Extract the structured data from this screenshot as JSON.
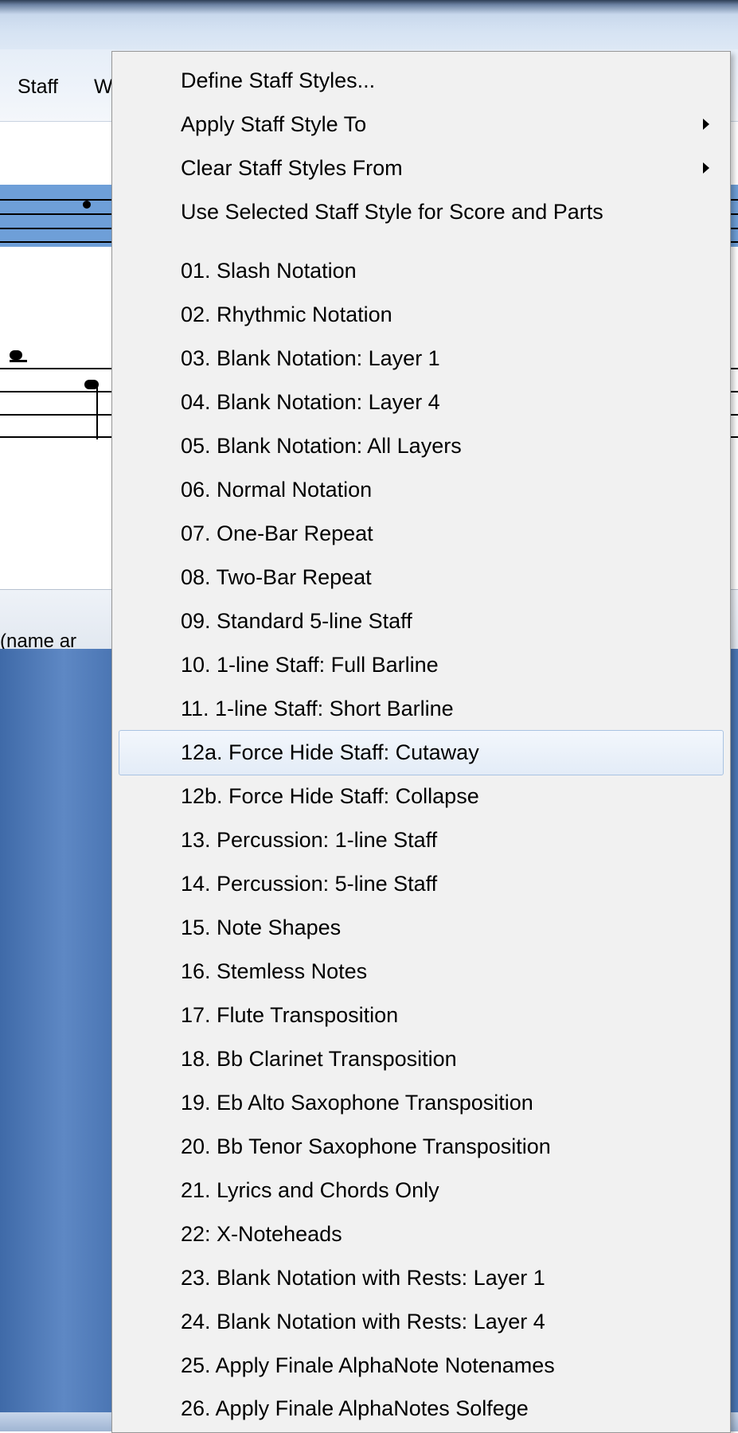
{
  "menubar": {
    "staff_label": "Staff",
    "window_label": "W"
  },
  "status": {
    "partial_text": "(name ar"
  },
  "context_menu": {
    "items": [
      {
        "label": "Define Staff Styles...",
        "submenu": false
      },
      {
        "label": "Apply Staff Style To",
        "submenu": true
      },
      {
        "label": "Clear Staff Styles From",
        "submenu": true
      },
      {
        "label": "Use Selected Staff Style for Score and Parts",
        "submenu": false
      },
      {
        "label": "01.  Slash Notation",
        "submenu": false
      },
      {
        "label": "02.  Rhythmic Notation",
        "submenu": false
      },
      {
        "label": "03.  Blank Notation:  Layer 1",
        "submenu": false
      },
      {
        "label": "04.  Blank Notation:  Layer 4",
        "submenu": false
      },
      {
        "label": "05.  Blank Notation:  All Layers",
        "submenu": false
      },
      {
        "label": "06.  Normal Notation",
        "submenu": false
      },
      {
        "label": "07.  One-Bar Repeat",
        "submenu": false
      },
      {
        "label": "08.  Two-Bar Repeat",
        "submenu": false
      },
      {
        "label": "09.  Standard 5-line Staff",
        "submenu": false
      },
      {
        "label": "10.  1-line Staff:  Full Barline",
        "submenu": false
      },
      {
        "label": "11.  1-line Staff:  Short Barline",
        "submenu": false
      },
      {
        "label": "12a. Force Hide Staff: Cutaway",
        "submenu": false,
        "highlighted": true
      },
      {
        "label": "12b. Force Hide Staff: Collapse",
        "submenu": false
      },
      {
        "label": "13.  Percussion:  1-line Staff",
        "submenu": false
      },
      {
        "label": "14.  Percussion:  5-line Staff",
        "submenu": false
      },
      {
        "label": "15.  Note Shapes",
        "submenu": false
      },
      {
        "label": "16.  Stemless Notes",
        "submenu": false
      },
      {
        "label": "17.  Flute Transposition",
        "submenu": false
      },
      {
        "label": "18.  Bb Clarinet Transposition",
        "submenu": false
      },
      {
        "label": "19.  Eb Alto Saxophone Transposition",
        "submenu": false
      },
      {
        "label": "20.  Bb Tenor Saxophone Transposition",
        "submenu": false
      },
      {
        "label": "21.  Lyrics and Chords Only",
        "submenu": false
      },
      {
        "label": "22:  X-Noteheads",
        "submenu": false
      },
      {
        "label": "23.  Blank Notation with Rests: Layer 1",
        "submenu": false
      },
      {
        "label": "24.  Blank Notation with Rests: Layer 4",
        "submenu": false
      },
      {
        "label": "25. Apply Finale AlphaNote Notenames",
        "submenu": false
      },
      {
        "label": "26. Apply Finale AlphaNotes Solfege",
        "submenu": false
      }
    ]
  },
  "colors": {
    "menu_bg": "#f1f1f1",
    "highlight_border": "#a9c3e2",
    "staff_selection": "#6e9fd8",
    "workspace_blue": "#4b76b4"
  }
}
